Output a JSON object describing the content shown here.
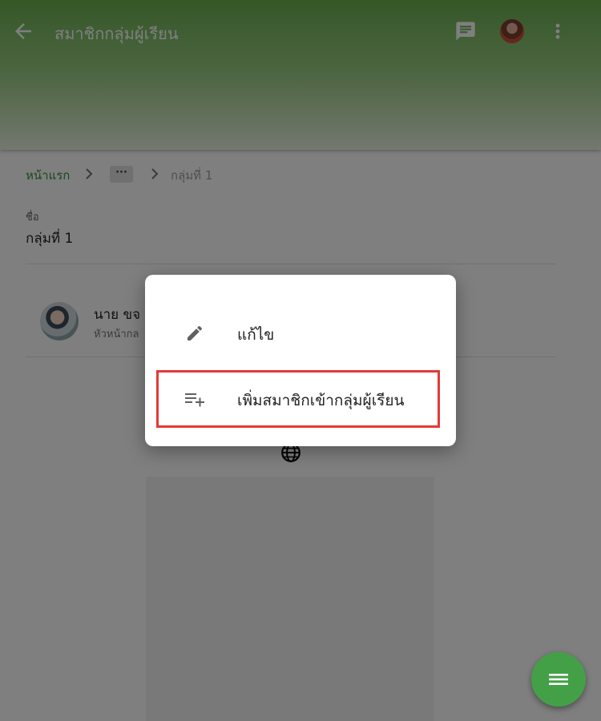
{
  "header": {
    "title": "สมาชิกกลุ่มผู้เรียน",
    "back_icon": "arrow-back-icon",
    "chat_icon": "chat-icon",
    "more_icon": "more-vert-icon"
  },
  "breadcrumb": {
    "home": "หน้าแรก",
    "ellipsis": "···",
    "current": "กลุ่มที่ 1"
  },
  "group": {
    "name_label": "ชื่อ",
    "name_value": "กลุ่มที่ 1"
  },
  "member": {
    "name": "นาย ขจ",
    "role": "หัวหน้ากล"
  },
  "menu": {
    "items": [
      {
        "label": "แก้ไข",
        "icon": "edit-pencil-icon"
      },
      {
        "label": "เพิ่มสมาชิกเข้ากลุ่มผู้เรียน",
        "icon": "playlist-add-icon",
        "highlighted": true
      }
    ]
  },
  "fab": {
    "icon": "menu-icon"
  },
  "colors": {
    "primary": "#43a047",
    "link": "#388e3c",
    "highlight": "#e53935"
  }
}
